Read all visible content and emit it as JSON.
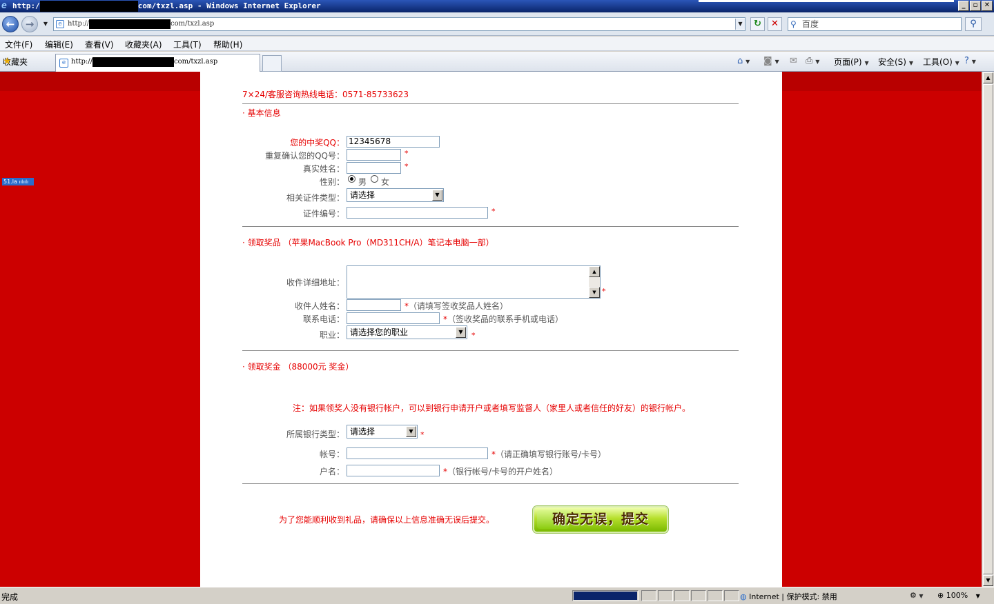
{
  "window": {
    "title_prefix": "http:/",
    "title_suffix": "com/txzl.asp - Windows Internet Explorer",
    "buttons": {
      "minimize": "_",
      "maximize": "▫",
      "close": "✕"
    }
  },
  "address_bar": {
    "url_prefix": "http://",
    "url_suffix": "com/txzl.asp",
    "search_placeholder": "百度"
  },
  "menu": [
    "文件(F)",
    "编辑(E)",
    "查看(V)",
    "收藏夹(A)",
    "工具(T)",
    "帮助(H)"
  ],
  "tabs": {
    "favorites_label": "收藏夹",
    "active_tab_prefix": "http://",
    "active_tab_suffix": "com/txzl.asp"
  },
  "command_bar": {
    "page": "页面(P)",
    "safety": "安全(S)",
    "tools": "工具(O)"
  },
  "page": {
    "counter_badge": "51.la",
    "hotline": "7×24/客服咨询热线电话：0571-85733623",
    "section_basic": "·   基本信息",
    "basic": {
      "qq_label": "您的中奖QQ：",
      "qq_value": "12345678",
      "qq_confirm_label": "重复确认您的QQ号：",
      "real_name_label": "真实姓名：",
      "gender_label": "性别：",
      "gender_male": "男",
      "gender_female": "女",
      "id_type_label": "相关证件类型：",
      "id_type_value": "请选择",
      "id_number_label": "证件编号："
    },
    "section_prize": "·   领取奖品 （苹果MacBook Pro（MD311CH/A）笔记本电脑一部）",
    "prize": {
      "address_label": "收件详细地址：",
      "recipient_label": "收件人姓名：",
      "recipient_hint": "（请填写签收奖品人姓名）",
      "phone_label": "联系电话：",
      "phone_hint": "（签收奖品的联系手机或电话）",
      "job_label": "职业：",
      "job_value": "请选择您的职业"
    },
    "section_cash": "·   领取奖金 （88000元 奖金）",
    "cash": {
      "note": "注：如果领奖人没有银行帐户，可以到银行申请开户或者填写监督人（家里人或者信任的好友）的银行帐户。",
      "bank_type_label": "所属银行类型：",
      "bank_type_value": "请选择",
      "account_label": "帐号：",
      "account_hint": "（请正确填写银行账号/卡号）",
      "holder_label": "户名：",
      "holder_hint": "（银行帐号/卡号的开户姓名）"
    },
    "footer_note": "为了您能顺利收到礼品，请确保以上信息准确无误后提交。",
    "submit_label": "确定无误，提交",
    "required_mark": "*"
  },
  "status": {
    "text": "完成",
    "progress": 1.0,
    "zone": "Internet | 保护模式: 禁用",
    "zoom": "100%"
  },
  "colors": {
    "page_bg": "#cc0000",
    "accent_red": "#e60000",
    "title_bar": "#0a246a"
  }
}
